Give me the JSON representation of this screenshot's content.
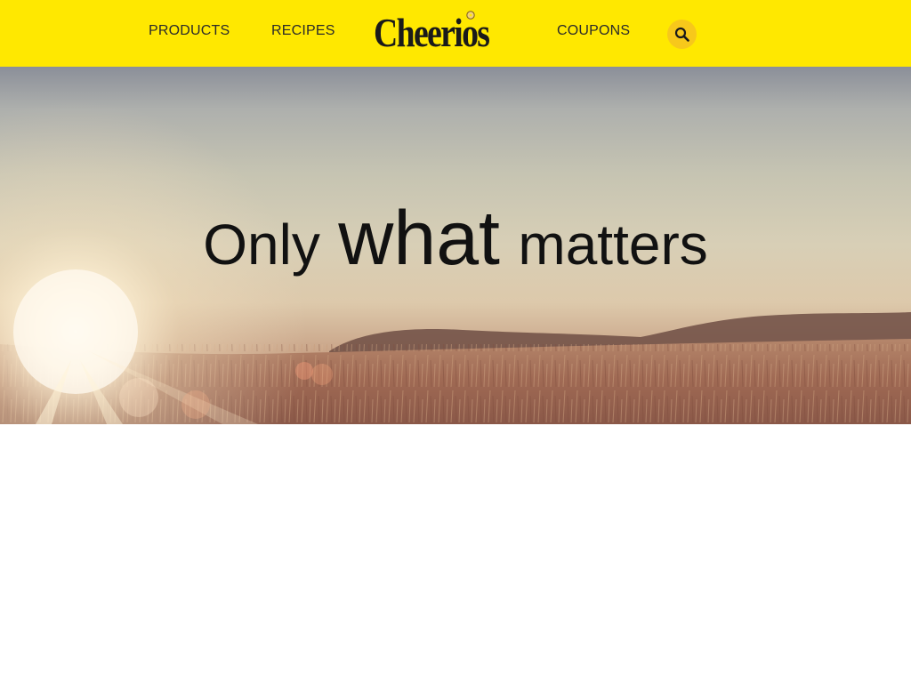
{
  "nav": {
    "products_label": "PRODUCTS",
    "recipes_label": "RECIPES",
    "coupons_label": "COUPONS",
    "logo_text": "Cheerios",
    "search_icon": "search-icon"
  },
  "hero": {
    "headline_word_1": "Only",
    "headline_word_2": "what",
    "headline_word_3": "matters"
  },
  "colors": {
    "header_bg": "#ffe800",
    "search_button_bg": "#f7c81b",
    "headline_text": "#111111"
  }
}
